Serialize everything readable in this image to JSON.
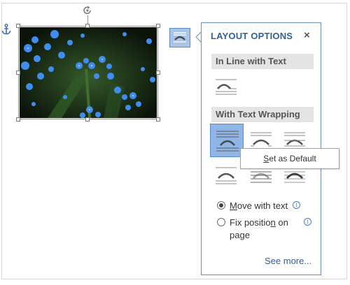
{
  "image": {
    "description_icon": "photo-blue-forget-me-not-flowers"
  },
  "icons": {
    "anchor": "anchor-icon",
    "rotate": "rotate-handle-icon",
    "layout_button": "layout-options-icon"
  },
  "panel": {
    "title": "LAYOUT OPTIONS",
    "close": "×",
    "section_inline": "In Line with Text",
    "section_wrapping": "With Text Wrapping",
    "tooltip": "Set as Default",
    "move_with_text_pre": "",
    "move_with_text_key": "M",
    "move_with_text_rest": "ove with text",
    "fix_position_pre": "Fix positio",
    "fix_position_key": "n",
    "fix_position_rest": " on",
    "fix_position_line2": "page",
    "see_more": "See more...",
    "tooltip_key": "S",
    "tooltip_rest": "et as Default",
    "info_glyph": "i"
  },
  "colors": {
    "accent": "#2e5f9e",
    "selected_bg": "#8fb6e6",
    "button_bg": "#a8c4e6",
    "flowers": "#3f8df0"
  }
}
